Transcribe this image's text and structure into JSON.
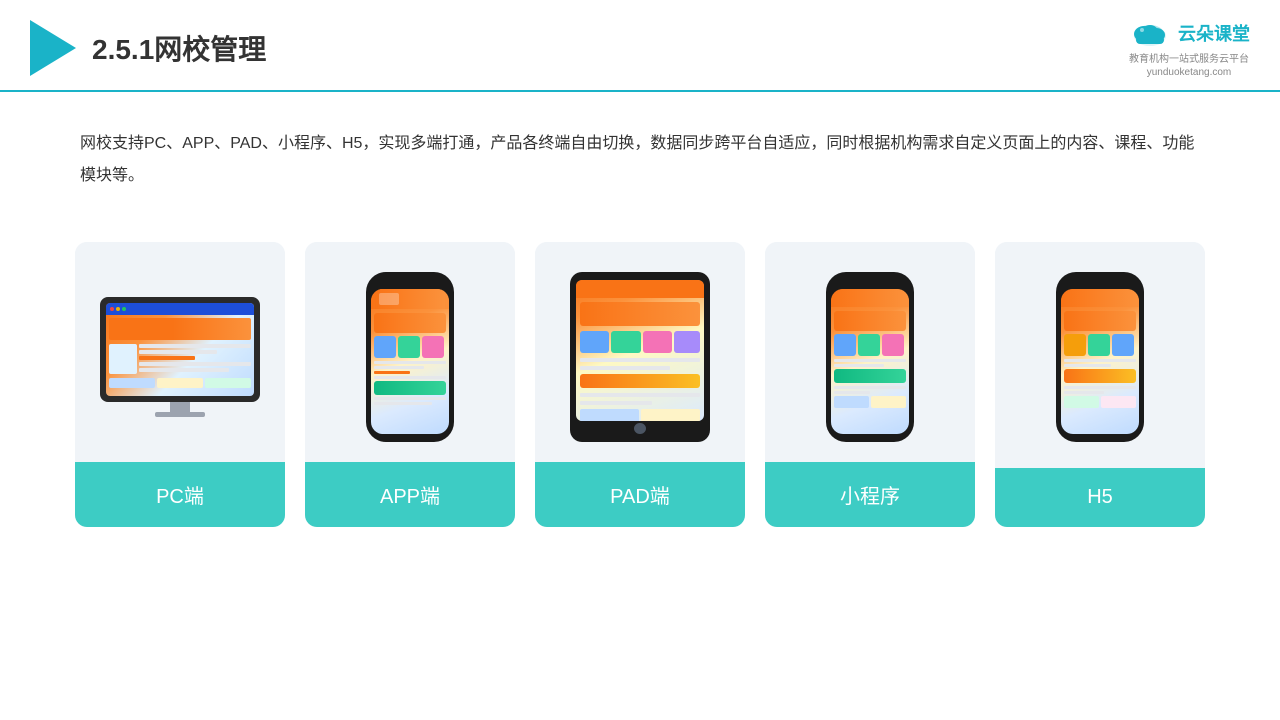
{
  "header": {
    "title": "2.5.1网校管理",
    "brand_name": "云朵课堂",
    "brand_slogan": "教育机构一站式服务云平台",
    "brand_url": "yunduoketang.com"
  },
  "description": {
    "text": "网校支持PC、APP、PAD、小程序、H5，实现多端打通，产品各终端自由切换，数据同步跨平台自适应，同时根据机构需求自定义页面上的内容、课程、功能模块等。"
  },
  "cards": [
    {
      "id": "pc",
      "label": "PC端"
    },
    {
      "id": "app",
      "label": "APP端"
    },
    {
      "id": "pad",
      "label": "PAD端"
    },
    {
      "id": "miniapp",
      "label": "小程序"
    },
    {
      "id": "h5",
      "label": "H5"
    }
  ]
}
